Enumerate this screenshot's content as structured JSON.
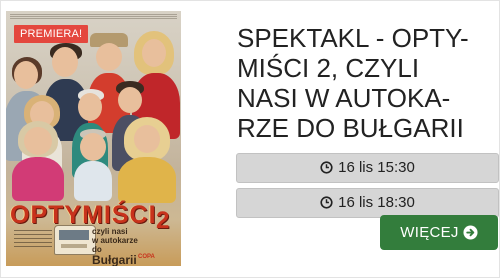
{
  "event": {
    "badge": "PREMIERA!",
    "title_lines": [
      "SPEKTAKL - OPTY-",
      "MIŚCI 2, CZYLI",
      "NASI W AUTOKA-",
      "RZE DO BUŁGARII"
    ]
  },
  "poster": {
    "title": "OPTYMIŚCI",
    "title_number": "2",
    "subtitle_lines": [
      "czyli nasi",
      "w autokarze",
      "do"
    ],
    "subtitle_big": "Bułgarii",
    "distributor": "COPA"
  },
  "showtimes": [
    {
      "label": "16 lis 15:30",
      "icon": "clock-icon"
    },
    {
      "label": "16 lis 18:30",
      "icon": "clock-icon"
    }
  ],
  "more_button": {
    "label": "WIĘCEJ",
    "icon": "circle-arrow-right-icon"
  },
  "colors": {
    "badge": "#e4473e",
    "more_button": "#337d3c",
    "showtime_button": "#d6d6d6",
    "title_text": "#222222",
    "poster_title": "#c8321c"
  }
}
